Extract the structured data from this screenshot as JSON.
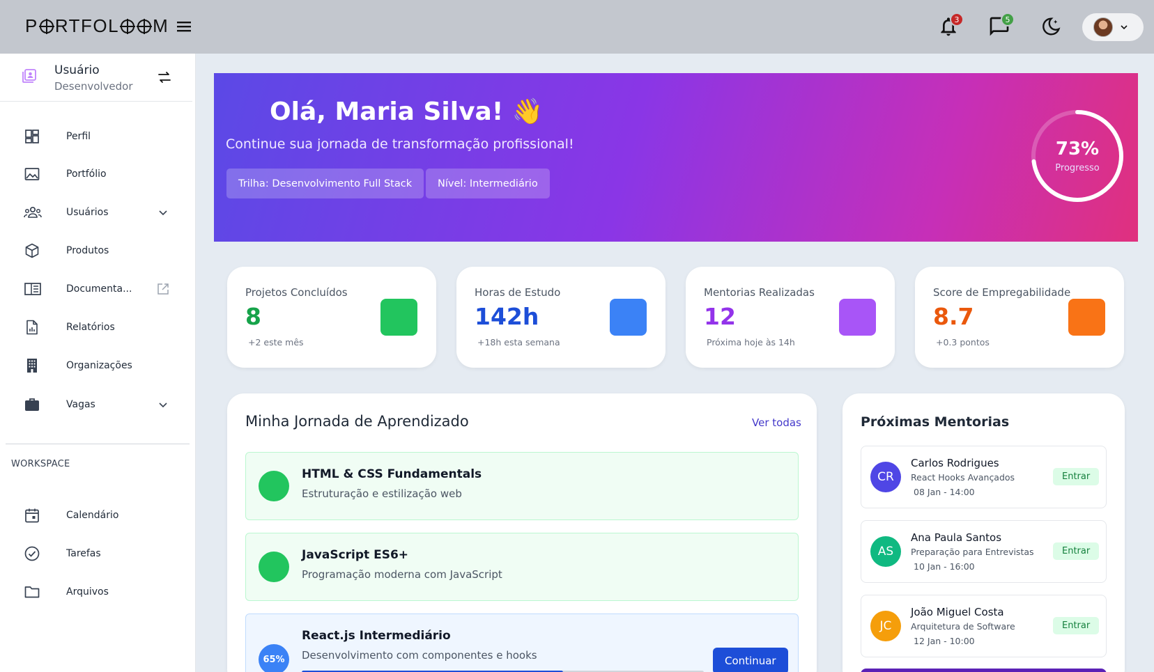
{
  "header": {
    "logo": "PORTFOLOOM",
    "notifications_count": "3",
    "messages_count": "5"
  },
  "sidebar": {
    "role_title": "Usuário",
    "role_subtitle": "Desenvolvedor",
    "items": [
      {
        "label": "Perfil",
        "icon": "dashboard-icon"
      },
      {
        "label": "Portfólio",
        "icon": "image-icon"
      },
      {
        "label": "Usuários",
        "icon": "users-icon",
        "expandable": true
      },
      {
        "label": "Produtos",
        "icon": "box-icon"
      },
      {
        "label": "Documenta...",
        "icon": "book-icon",
        "external": true
      },
      {
        "label": "Relatórios",
        "icon": "report-icon"
      },
      {
        "label": "Organizações",
        "icon": "building-icon"
      },
      {
        "label": "Vagas",
        "icon": "briefcase-icon",
        "expandable": true
      }
    ],
    "section_label": "WORKSPACE",
    "workspace_items": [
      {
        "label": "Calendário",
        "icon": "calendar-icon"
      },
      {
        "label": "Tarefas",
        "icon": "check-circle-icon"
      },
      {
        "label": "Arquivos",
        "icon": "folder-icon"
      }
    ]
  },
  "hero": {
    "title": "Olá, Maria Silva! 👋",
    "subtitle": "Continue sua jornada de transformação profissional!",
    "chip_track": "Trilha: Desenvolvimento Full Stack",
    "chip_level": "Nível: Intermediário",
    "progress_value": "73%",
    "progress_fraction": 0.73,
    "progress_label": "Progresso"
  },
  "stats": [
    {
      "label": "Projetos Concluídos",
      "value": "8",
      "note": "+2 este mês",
      "color": "#16a34a",
      "square": "#22c55e"
    },
    {
      "label": "Horas de Estudo",
      "value": "142h",
      "note": "+18h esta semana",
      "color": "#1d4ed8",
      "square": "#3b82f6"
    },
    {
      "label": "Mentorias Realizadas",
      "value": "12",
      "note": "Próxima hoje às 14h",
      "color": "#9333ea",
      "square": "#a855f7"
    },
    {
      "label": "Score de Empregabilidade",
      "value": "8.7",
      "note": "+0.3 pontos",
      "color": "#ea580c",
      "square": "#f97316"
    }
  ],
  "journey": {
    "title": "Minha Jornada de Aprendizado",
    "see_all": "Ver todas",
    "courses": [
      {
        "title": "HTML & CSS Fundamentals",
        "desc": "Estruturação e estilização web",
        "status": "done"
      },
      {
        "title": "JavaScript ES6+",
        "desc": "Programação moderna com JavaScript",
        "status": "done"
      },
      {
        "title": "React.js Intermediário",
        "desc": "Desenvolvimento com componentes e hooks",
        "status": "active",
        "progress": "65%",
        "progress_fraction": 0.65,
        "button": "Continuar"
      }
    ]
  },
  "mentorias": {
    "title": "Próximas Mentorias",
    "items": [
      {
        "initials": "CR",
        "name": "Carlos Rodrigues",
        "topic": "React Hooks Avançados",
        "date": "08 Jan - 14:00",
        "button": "Entrar",
        "color": "#4f46e5"
      },
      {
        "initials": "AS",
        "name": "Ana Paula Santos",
        "topic": "Preparação para Entrevistas",
        "date": "10 Jan - 16:00",
        "button": "Entrar",
        "color": "#10b981"
      },
      {
        "initials": "JC",
        "name": "João Miguel Costa",
        "topic": "Arquitetura de Software",
        "date": "12 Jan - 10:00",
        "button": "Entrar",
        "color": "#f59e0b"
      }
    ]
  }
}
